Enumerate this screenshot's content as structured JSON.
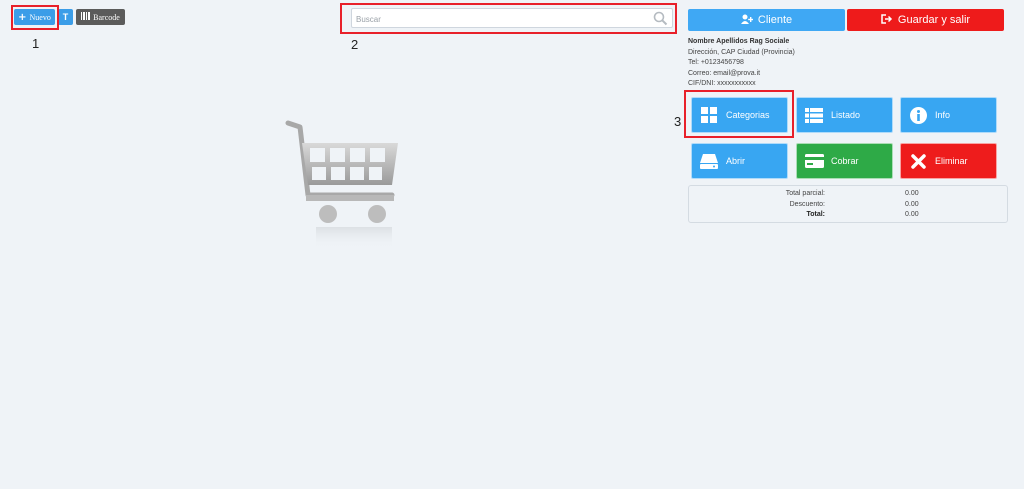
{
  "toolbar": {
    "new_label": "Nuevo",
    "t_label": "T",
    "barcode_label": "Barcode"
  },
  "annotations": [
    "1",
    "2",
    "3"
  ],
  "search": {
    "placeholder": "Buscar",
    "value": ""
  },
  "header_buttons": {
    "client_label": "Cliente",
    "save_exit_label": "Guardar y salir"
  },
  "client": {
    "name": "Nombre Apellidos Rag Sociale",
    "address": "Dirección, CAP Ciudad (Provincia)",
    "phone": "Tel: +0123456798",
    "email": "Correo: email@prova.it",
    "tax_id": "CIF/DNI: xxxxxxxxxxx"
  },
  "actions": [
    {
      "label": "Categorias",
      "icon": "grid-icon",
      "color": "#38a6f2"
    },
    {
      "label": "Listado",
      "icon": "list-icon",
      "color": "#38a6f2"
    },
    {
      "label": "Info",
      "icon": "info-icon",
      "color": "#38a6f2"
    },
    {
      "label": "Abrir",
      "icon": "drive-icon",
      "color": "#38a6f2"
    },
    {
      "label": "Cobrar",
      "icon": "credit-card-icon",
      "color": "#2eaa47"
    },
    {
      "label": "Eliminar",
      "icon": "close-icon",
      "color": "#ee1c1c"
    }
  ],
  "totals": {
    "subtotal_label": "Total parcial:",
    "subtotal_value": "0.00",
    "discount_label": "Descuento:",
    "discount_value": "0.00",
    "total_label": "Total:",
    "total_value": "0.00"
  },
  "colors": {
    "primary_blue": "#3fa8f4",
    "danger_red": "#ee1b1b",
    "success_green": "#2eaa47",
    "highlight_red": "#e8202a"
  }
}
